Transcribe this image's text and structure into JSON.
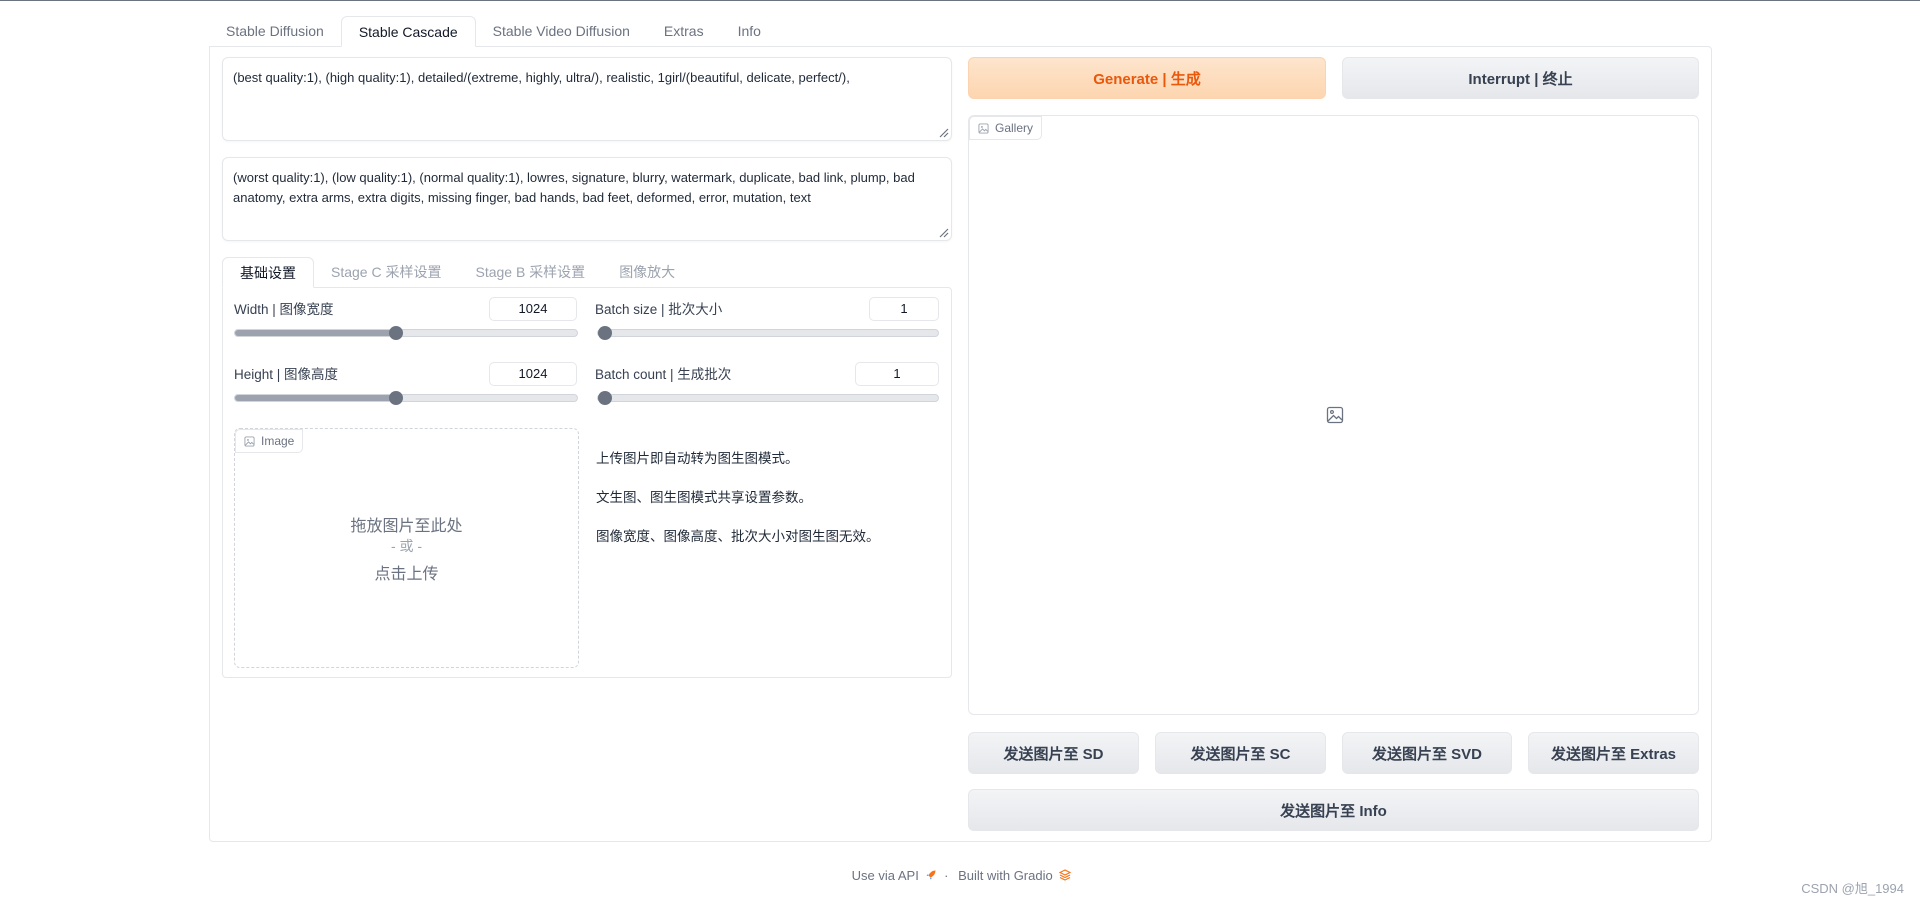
{
  "main_tabs": [
    "Stable Diffusion",
    "Stable Cascade",
    "Stable Video Diffusion",
    "Extras",
    "Info"
  ],
  "active_main_tab": "Stable Cascade",
  "prompts": {
    "positive": "(best quality:1), (high quality:1), detailed/(extreme, highly, ultra/), realistic, 1girl/(beautiful, delicate, perfect/),",
    "negative": "(worst quality:1), (low quality:1), (normal quality:1), lowres, signature, blurry, watermark, duplicate, bad link, plump, bad anatomy, extra arms, extra digits, missing finger, bad hands, bad feet, deformed, error, mutation, text"
  },
  "sub_tabs": [
    "基础设置",
    "Stage C 采样设置",
    "Stage B 采样设置",
    "图像放大"
  ],
  "active_sub_tab": "基础设置",
  "sliders": {
    "width": {
      "label": "Width | 图像宽度",
      "value": "1024",
      "fraction": 0.47
    },
    "height": {
      "label": "Height | 图像高度",
      "value": "1024",
      "fraction": 0.47
    },
    "batch_size": {
      "label": "Batch size | 批次大小",
      "value": "1",
      "fraction": 0.0
    },
    "batch_count": {
      "label": "Batch count | 生成批次",
      "value": "1",
      "fraction": 0.0
    }
  },
  "image_upload": {
    "label": "Image",
    "line1": "拖放图片至此处",
    "line2": "- 或 -",
    "line3": "点击上传"
  },
  "info_lines": [
    "上传图片即自动转为图生图模式。",
    "文生图、图生图模式共享设置参数。",
    "图像宽度、图像高度、批次大小对图生图无效。"
  ],
  "buttons": {
    "generate": "Generate | 生成",
    "interrupt": "Interrupt | 终止",
    "send_sd": "发送图片至 SD",
    "send_sc": "发送图片至 SC",
    "send_svd": "发送图片至 SVD",
    "send_extras": "发送图片至 Extras",
    "send_info": "发送图片至 Info"
  },
  "gallery": {
    "label": "Gallery"
  },
  "footer": {
    "api": "Use via API",
    "dot": "·",
    "built": "Built with Gradio"
  },
  "watermark": "CSDN @旭_1994"
}
